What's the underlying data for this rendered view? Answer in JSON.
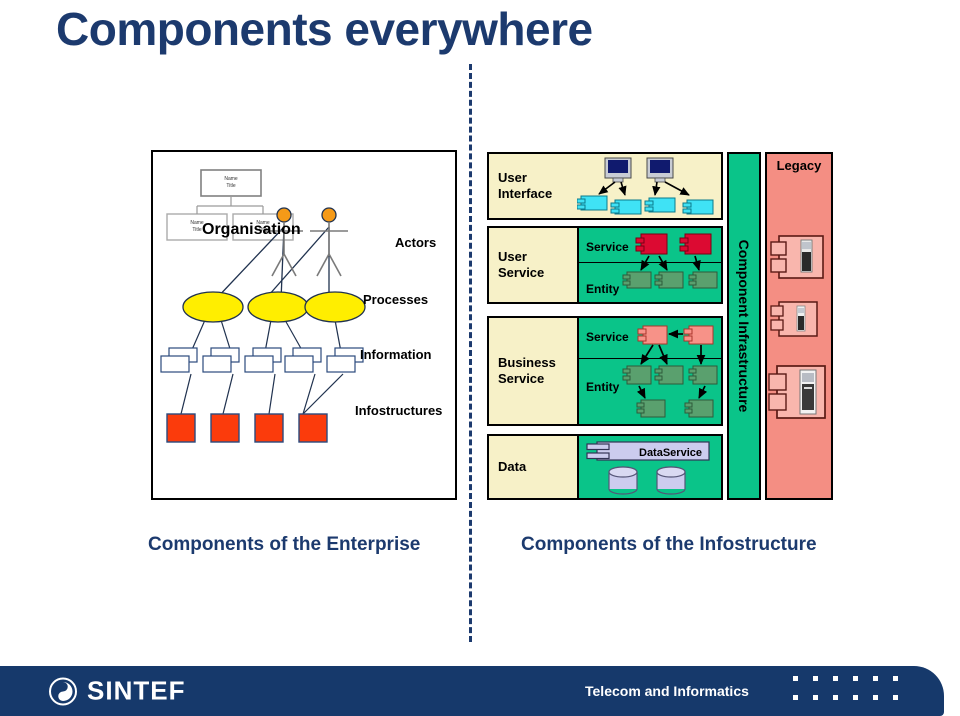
{
  "slide": {
    "title": "Components everywhere"
  },
  "enterprise": {
    "org_box_line1": "Name",
    "org_box_line2": "Title",
    "labels": {
      "organisation": "Organisation",
      "actors": "Actors",
      "processes": "Processes",
      "information": "Information",
      "infostructures": "Infostructures"
    },
    "counts": {
      "org_boxes": 3,
      "actors": 2,
      "processes": 3,
      "information": 5,
      "infostructures": 4
    },
    "colors": {
      "process_fill": "#ffee00",
      "actor_head": "#f59a18",
      "infostructure_fill": "#fb3b0c",
      "outline": "#2b4a7d"
    }
  },
  "infostructure": {
    "bands": [
      {
        "id": "ui",
        "label": "User\nInterface",
        "label_line1": "User",
        "label_line2": "Interface"
      },
      {
        "id": "us",
        "label": "User Service",
        "label_line1": "User",
        "label_line2": "Service"
      },
      {
        "id": "bs",
        "label": "Business Service",
        "label_line1": "Business",
        "label_line2": "Service"
      },
      {
        "id": "data",
        "label": "Data",
        "label_line1": "Data",
        "label_line2": ""
      }
    ],
    "sub_labels": {
      "service": "Service",
      "entity": "Entity"
    },
    "data_service_label": "DataService",
    "counts": {
      "ui_monitors": 2,
      "ui_components": 4,
      "user_service_service": 2,
      "user_service_entity": 3,
      "business_service_service": 2,
      "business_service_entity": 5,
      "databases": 2
    },
    "colors": {
      "band_label_bg": "#f7f1c8",
      "band_body_bg": "#0ac489",
      "ui_component": "#3fe2f5",
      "user_service_component": "#dc0a32",
      "business_service_component": "#f79288",
      "entity_component": "#5aa06e",
      "data_component": "#ccccee",
      "monitor_screen": "#101a6e"
    }
  },
  "component_infrastructure": {
    "label": "Component Infrastructure",
    "color": "#0ac489"
  },
  "legacy": {
    "title": "Legacy",
    "color": "#f48e83",
    "box_fill": "#f9b6ad",
    "systems": 3
  },
  "captions": {
    "left": "Components of the Enterprise",
    "right": "Components of the Infostructure"
  },
  "footer": {
    "brand": "SINTEF",
    "tagline": "Telecom and Informatics",
    "bg_color": "#16396b",
    "dot_count": 12
  }
}
